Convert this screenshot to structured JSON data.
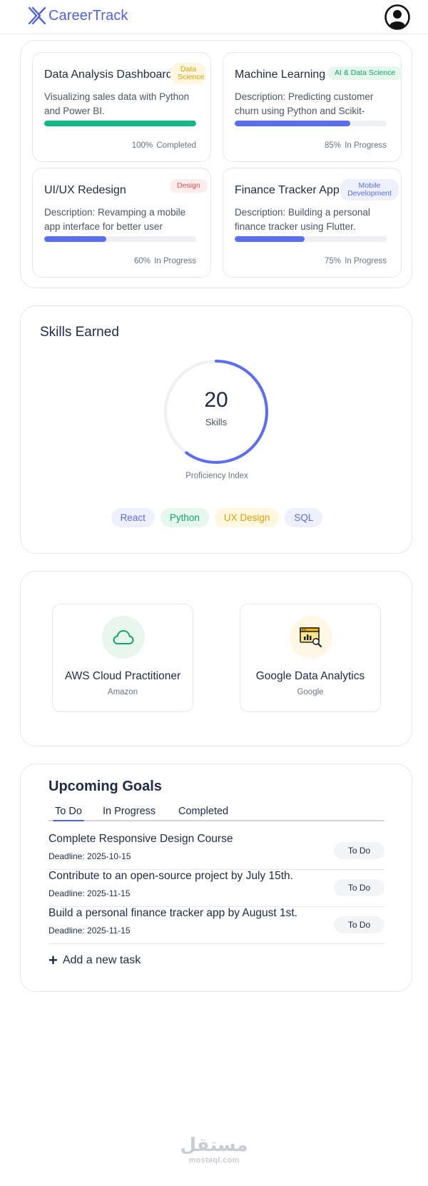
{
  "header": {
    "logo_text": "CareerTrack",
    "logo_icon": "x-logo-icon",
    "profile_icon": "user-circle-icon"
  },
  "projects": [
    {
      "title": "Data Analysis Dashboard",
      "badge": "Data Science",
      "badge_color": "#e3a008",
      "badge_bg": "#fff7e0",
      "description": "Visualizing sales data with Python and Power BI.",
      "progress": 100,
      "progress_label": "100%",
      "status": "Completed",
      "bar_color": "#10b981"
    },
    {
      "title": "Machine Learning",
      "badge": "AI & Data Science",
      "badge_color": "#10a36f",
      "badge_bg": "#e5f7ef",
      "description": "Description: Predicting customer churn using Python and Scikit-Learn.",
      "progress": 76,
      "progress_label": "85%",
      "status": "In Progress",
      "bar_color": "#5b6df0"
    },
    {
      "title": "UI/UX Redesign",
      "badge": "Design",
      "badge_color": "#e05252",
      "badge_bg": "#fdecec",
      "description": "Description: Revamping a mobile app interface for better user experience.",
      "progress": 41,
      "progress_label": "60%",
      "status": "In Progress",
      "bar_color": "#5b6df0"
    },
    {
      "title": "Finance Tracker App",
      "badge": "Mobile Development",
      "badge_color": "#5b6df0",
      "badge_bg": "#eef0fd",
      "description": "Description: Building a personal finance tracker using Flutter.",
      "progress": 46,
      "progress_label": "75%",
      "status": "In Progress",
      "bar_color": "#5b6df0"
    }
  ],
  "skills": {
    "title": "Skills Earned",
    "count": "20",
    "count_label": "Skills",
    "index_label": "Proficiency Index",
    "ring_fraction": 0.6,
    "ring_color": "#5b6df0",
    "tags": [
      {
        "label": "React",
        "color": "#5b6df0",
        "bg": "#eef0fd"
      },
      {
        "label": "Python",
        "color": "#10a36f",
        "bg": "#e5f7ef"
      },
      {
        "label": "UX Design",
        "color": "#e3a008",
        "bg": "#fff7e0"
      },
      {
        "label": "SQL",
        "color": "#5b6df0",
        "bg": "#eef0fd"
      }
    ]
  },
  "certificates": [
    {
      "name": "AWS Cloud Practitioner",
      "issuer": "Amazon",
      "icon": "cloud-icon",
      "icon_bg": "#e8f6ef"
    },
    {
      "name": "Google Data Analytics",
      "issuer": "Google",
      "icon": "analytics-chart-icon",
      "icon_bg": "#fff7e6"
    }
  ],
  "goals": {
    "title": "Upcoming Goals",
    "tabs": [
      "To Do",
      "In Progress",
      "Completed"
    ],
    "active_tab": "To Do",
    "items": [
      {
        "text": "Complete Responsive Design Course",
        "deadline": "Deadline: 2025-10-15",
        "status": "To Do"
      },
      {
        "text": "Contribute to an open-source project by July 15th.",
        "deadline": "Deadline: 2025-11-15",
        "status": "To Do"
      },
      {
        "text": "Build a personal finance tracker app by August 1st.",
        "deadline": "Deadline: 2025-11-15",
        "status": "To Do"
      }
    ],
    "add_label": "Add a new task"
  },
  "watermark": {
    "arabic": "مستقل",
    "latin": "mostaql.com"
  }
}
